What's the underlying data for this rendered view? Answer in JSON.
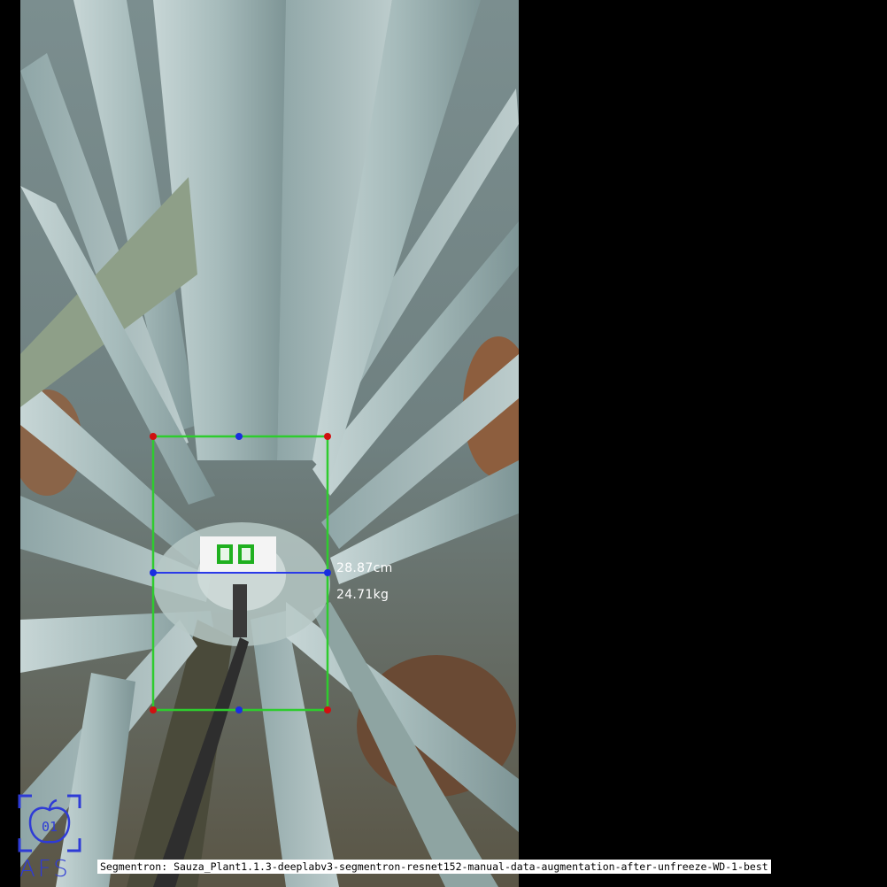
{
  "measurement": {
    "width_label": "28.87cm",
    "weight_label": "24.71kg"
  },
  "caption": "Segmentron: Sauza_Plant1.1.3-deeplabv3-segmentron-resnet152-manual-data-augmentation-after-unfreeze-WD-1-best",
  "logo": {
    "badge_text": "01",
    "text": "AFS"
  },
  "colors": {
    "bbox": "#2ecc2e",
    "corner_points": "#d01010",
    "mid_points": "#1a2ee0",
    "width_line": "#2a3ae8",
    "logo": "#2e3bd6",
    "leaf": "#9fb5b6",
    "soil": "#8a5a3a"
  },
  "icons": {
    "logo": "apple-logo-icon"
  }
}
